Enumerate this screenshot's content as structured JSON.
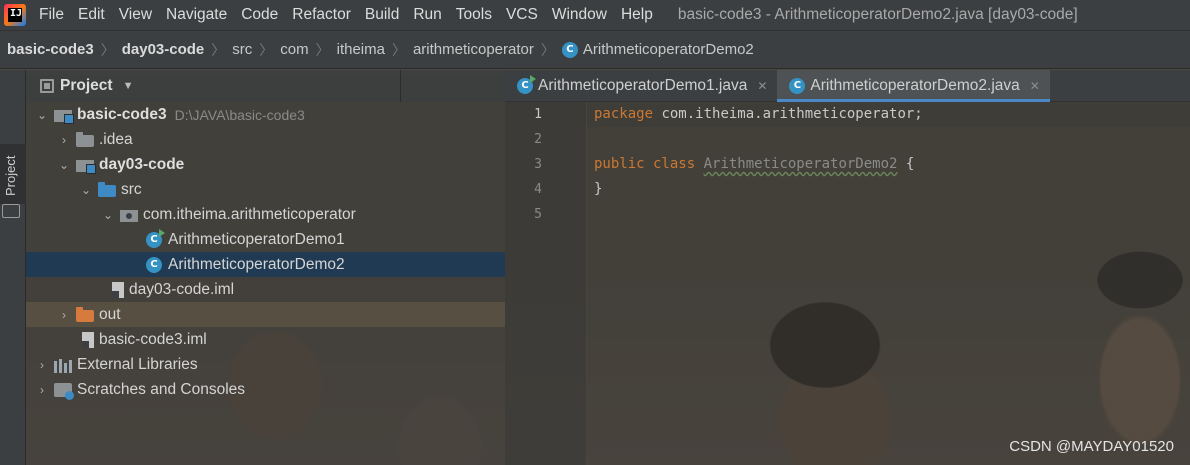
{
  "menubar": {
    "items": [
      {
        "label": "File"
      },
      {
        "label": "Edit"
      },
      {
        "label": "View"
      },
      {
        "label": "Navigate"
      },
      {
        "label": "Code"
      },
      {
        "label": "Refactor"
      },
      {
        "label": "Build"
      },
      {
        "label": "Run"
      },
      {
        "label": "Tools"
      },
      {
        "label": "VCS"
      },
      {
        "label": "Window"
      },
      {
        "label": "Help"
      }
    ],
    "window_title": "basic-code3 - ArithmeticoperatorDemo2.java [day03-code]"
  },
  "breadcrumb": [
    "basic-code3",
    "day03-code",
    "src",
    "com",
    "itheima",
    "arithmeticoperator",
    "ArithmeticoperatorDemo2"
  ],
  "toolstrip": {
    "project_label": "Project"
  },
  "project_panel": {
    "title": "Project"
  },
  "tree": [
    {
      "label": "basic-code3",
      "path": "D:\\JAVA\\basic-code3"
    },
    {
      "label": ".idea"
    },
    {
      "label": "day03-code"
    },
    {
      "label": "src"
    },
    {
      "label": "com.itheima.arithmeticoperator"
    },
    {
      "label": "ArithmeticoperatorDemo1"
    },
    {
      "label": "ArithmeticoperatorDemo2"
    },
    {
      "label": "day03-code.iml"
    },
    {
      "label": "out"
    },
    {
      "label": "basic-code3.iml"
    },
    {
      "label": "External Libraries"
    },
    {
      "label": "Scratches and Consoles"
    }
  ],
  "editor": {
    "tabs": [
      {
        "label": "ArithmeticoperatorDemo1.java",
        "active": false
      },
      {
        "label": "ArithmeticoperatorDemo2.java",
        "active": true
      }
    ],
    "line_numbers": [
      "1",
      "2",
      "3",
      "4",
      "5"
    ],
    "code": {
      "l1_kw": "package",
      "l1_rest": " com.itheima.arithmeticoperator;",
      "l3_kw": "public class",
      "l3_class": "ArithmeticoperatorDemo2",
      "l3_rest": " {",
      "l4": "}"
    }
  },
  "watermark": "CSDN @MAYDAY01520",
  "colors": {
    "keyword": "#cc7832",
    "selection": "#1f3a52",
    "tab_underline": "#4a88c7"
  }
}
